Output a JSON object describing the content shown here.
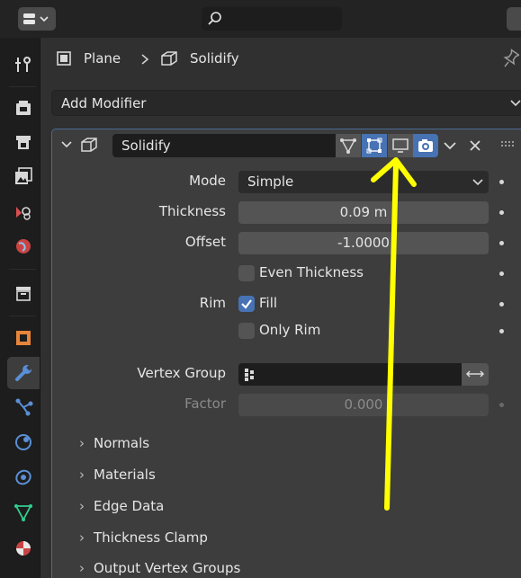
{
  "breadcrumb": {
    "object": "Plane",
    "modifier": "Solidify"
  },
  "add_modifier_label": "Add Modifier",
  "modifier": {
    "name": "Solidify",
    "fields": {
      "mode": {
        "label": "Mode",
        "value": "Simple"
      },
      "thickness": {
        "label": "Thickness",
        "value": "0.09 m"
      },
      "offset": {
        "label": "Offset",
        "value": "-1.0000"
      },
      "even_thickness": {
        "label": "Even Thickness",
        "checked": false
      },
      "rim": {
        "label": "Rim"
      },
      "fill": {
        "label": "Fill",
        "checked": true
      },
      "only_rim": {
        "label": "Only Rim",
        "checked": false
      },
      "vertex_group": {
        "label": "Vertex Group",
        "value": ""
      },
      "factor": {
        "label": "Factor",
        "value": "0.000"
      }
    },
    "subpanels": [
      "Normals",
      "Materials",
      "Edge Data",
      "Thickness Clamp",
      "Output Vertex Groups"
    ]
  },
  "icons": {
    "tabs": [
      "tool-icon",
      "render-icon",
      "output-icon",
      "view-layer-icon",
      "scene-icon",
      "world-icon",
      "collection-icon",
      "object-icon",
      "modifier-icon",
      "particles-icon",
      "physics-icon",
      "constraints-icon",
      "data-icon",
      "material-icon"
    ],
    "active_tab": "modifier-icon"
  },
  "colors": {
    "accent": "#4772b3",
    "annotation_arrow": "#ffff00",
    "modifier_icon": "#5a8fd6",
    "object_icon": "#e7853a"
  }
}
